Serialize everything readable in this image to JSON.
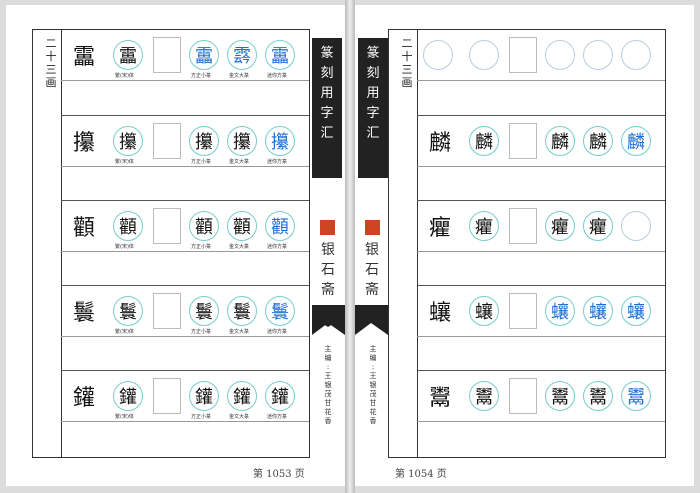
{
  "left": {
    "stroke_label": [
      "二",
      "十",
      "三",
      "画"
    ],
    "page_label": "第 1053 页",
    "rows": [
      {
        "big": "靁",
        "std": "靁",
        "caption_std": "繁(宋)体",
        "variants": [
          "",
          "靁",
          "𩃬",
          "靁"
        ],
        "variant_captions": [
          "方正小篆",
          "金文大篆",
          "迷你方篆"
        ],
        "blue": [
          false,
          true,
          true,
          true
        ]
      },
      {
        "big": "攥",
        "std": "攥",
        "caption_std": "繁(宋)体",
        "variants": [
          "𢺁",
          "攥",
          "攥",
          "攥"
        ],
        "variant_captions": [
          "方正小篆",
          "金文大篆",
          "迷你方篆"
        ],
        "blue": [
          false,
          false,
          false,
          true
        ]
      },
      {
        "big": "顴",
        "std": "顴",
        "caption_std": "繁(宋)体",
        "variants": [
          "顴",
          "顴",
          "顴",
          "顴"
        ],
        "variant_captions": [
          "方正小篆",
          "金文大篆",
          "迷你方篆"
        ],
        "blue": [
          false,
          false,
          false,
          true
        ]
      },
      {
        "big": "鬟",
        "std": "鬟",
        "caption_std": "繁(宋)体",
        "variants": [
          "鬟",
          "鬟",
          "鬟",
          "鬟"
        ],
        "variant_captions": [
          "方正小篆",
          "金文大篆",
          "迷你方篆"
        ],
        "blue": [
          false,
          false,
          false,
          true
        ]
      },
      {
        "big": "鑵",
        "std": "鑵",
        "caption_std": "繁(宋)体",
        "variants": [
          "鑵",
          "鑵",
          "鑵",
          "鑵"
        ],
        "variant_captions": [
          "方正小篆",
          "金文大篆",
          "迷你方篆"
        ],
        "blue": [
          false,
          false,
          false,
          false
        ]
      }
    ]
  },
  "right": {
    "stroke_label": [
      "二",
      "十",
      "三",
      "画"
    ],
    "page_label": "第 1054 页",
    "rows": [
      {
        "big": "",
        "std": "",
        "variants": [
          "",
          "",
          "",
          ""
        ],
        "empty": true
      },
      {
        "big": "麟",
        "std": "麟",
        "variants": [
          "麟",
          "麟",
          "麟",
          "麟"
        ],
        "blue": [
          false,
          false,
          false,
          true
        ]
      },
      {
        "big": "癯",
        "std": "癯",
        "variants": [
          "癯",
          "癯",
          "癯",
          ""
        ],
        "blue": [
          false,
          false,
          false,
          false
        ]
      },
      {
        "big": "蠰",
        "std": "蠰",
        "variants": [
          "",
          "蠰",
          "蠰",
          "蠰"
        ],
        "blue": [
          true,
          true,
          true,
          true
        ]
      },
      {
        "big": "鬻",
        "std": "鬻",
        "variants": [
          "鬻",
          "鬻",
          "鬻",
          "鬻"
        ],
        "blue": [
          false,
          false,
          false,
          true
        ]
      }
    ]
  },
  "spine": {
    "title": [
      "篆",
      "刻",
      "用",
      "字",
      "汇"
    ],
    "publisher": [
      "银",
      "石",
      "斋"
    ],
    "editor_left": [
      "主",
      "编",
      ":",
      "王",
      "银",
      "茂",
      " ",
      "甘",
      "花",
      "香"
    ],
    "editor_right": [
      "主",
      "编",
      ":",
      "王",
      "银",
      "茂",
      " ",
      "甘",
      "花",
      "香"
    ]
  }
}
